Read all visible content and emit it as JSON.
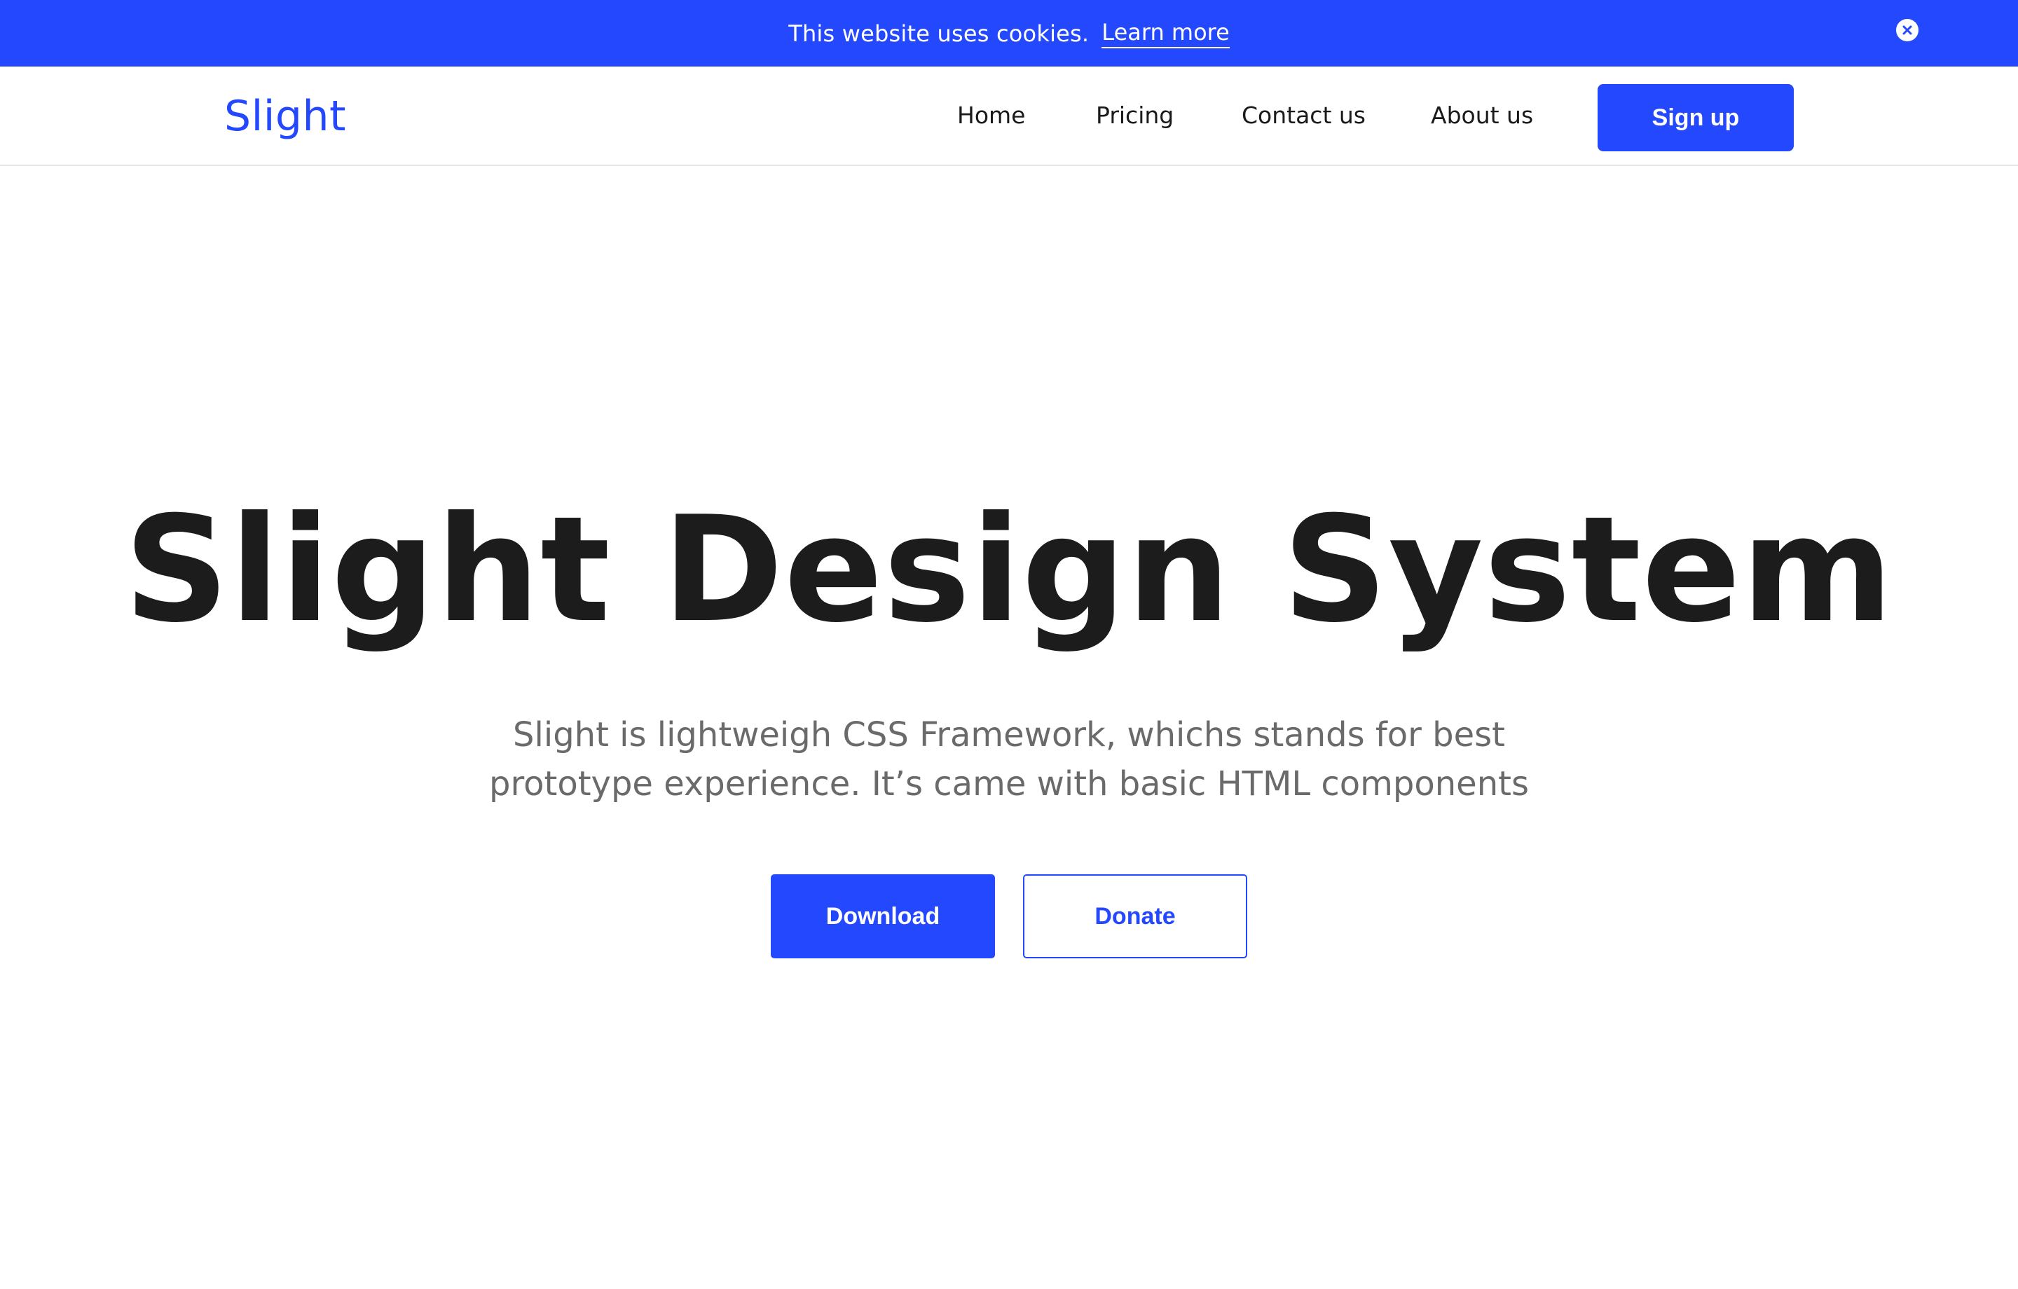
{
  "cookie_banner": {
    "message": "This website uses cookies.",
    "link_label": "Learn more",
    "close_icon": "close-icon"
  },
  "header": {
    "brand": "Slight",
    "nav": [
      {
        "label": "Home"
      },
      {
        "label": "Pricing"
      },
      {
        "label": "Contact us"
      },
      {
        "label": "About us"
      }
    ],
    "signup_label": "Sign up"
  },
  "hero": {
    "title": "Slight Design System",
    "subtitle_lines": [
      "Slight is lightweigh CSS Framework, whichs stands for best",
      "prototype experience. It’s came with basic HTML components"
    ],
    "download_label": "Download",
    "donate_label": "Donate"
  },
  "colors": {
    "accent": "#2448fd",
    "heading": "#1c1c1c",
    "subtext": "#6a6a6a",
    "background": "#ffffff"
  }
}
